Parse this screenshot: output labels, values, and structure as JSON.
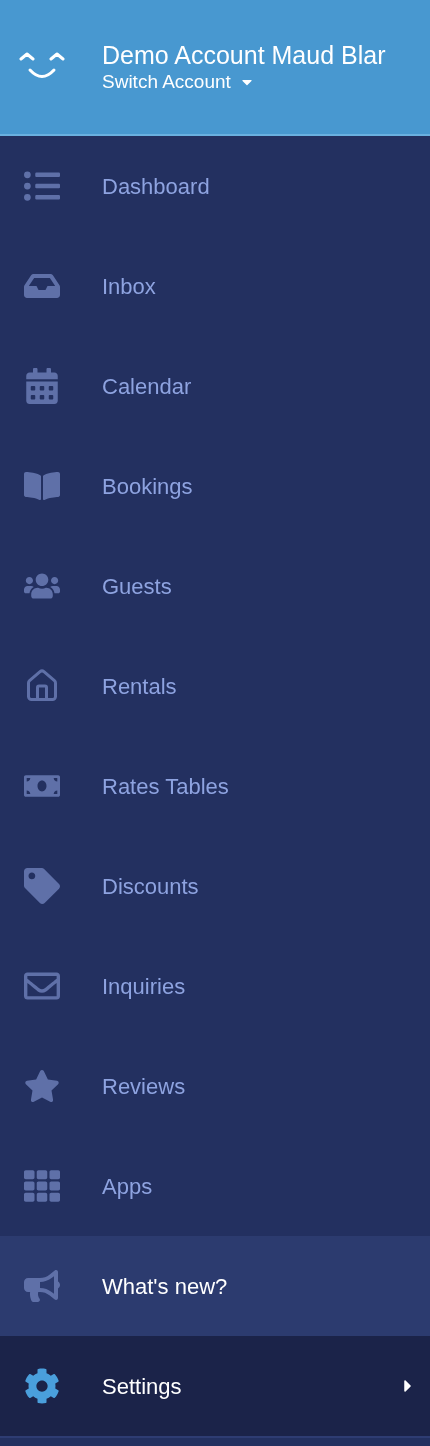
{
  "header": {
    "account_name": "Demo Account Maud Blar",
    "switch_label": "Switch Account"
  },
  "nav": [
    {
      "label": "Dashboard",
      "kind": "link"
    },
    {
      "label": "Inbox",
      "kind": "link"
    },
    {
      "label": "Calendar",
      "kind": "link"
    },
    {
      "label": "Bookings",
      "kind": "link"
    },
    {
      "label": "Guests",
      "kind": "link"
    },
    {
      "label": "Rentals",
      "kind": "link"
    },
    {
      "label": "Rates Tables",
      "kind": "link"
    },
    {
      "label": "Discounts",
      "kind": "link"
    },
    {
      "label": "Inquiries",
      "kind": "link"
    },
    {
      "label": "Reviews",
      "kind": "link"
    },
    {
      "label": "Apps",
      "kind": "link"
    },
    {
      "label": "What's new?",
      "kind": "news"
    },
    {
      "label": "Settings",
      "kind": "submenu"
    }
  ]
}
